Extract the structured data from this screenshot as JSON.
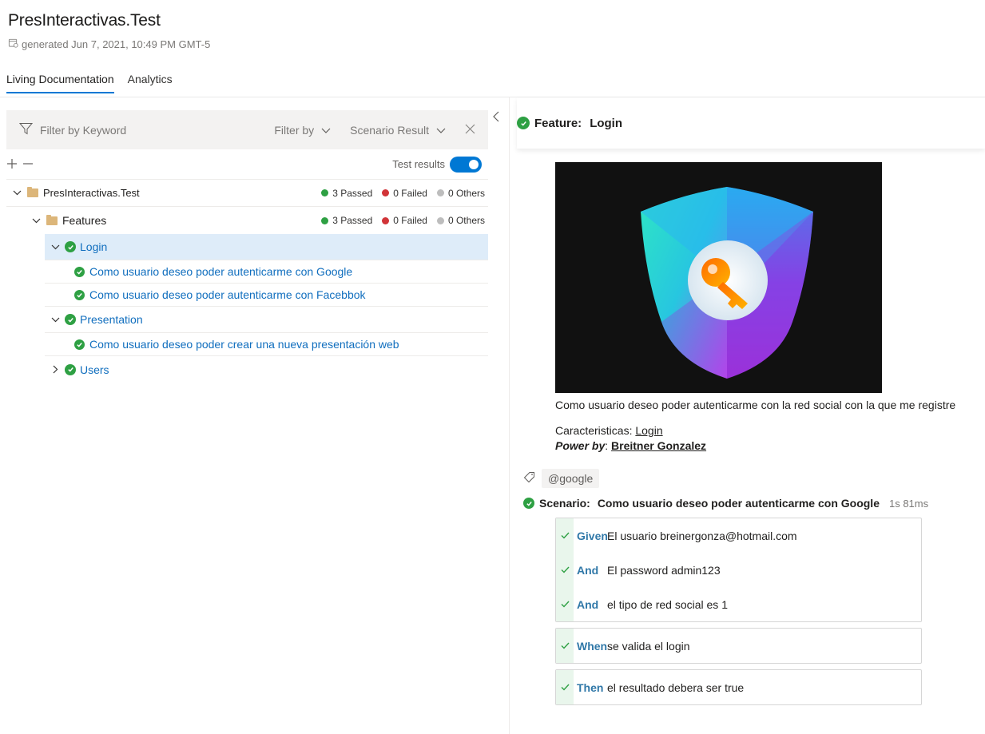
{
  "header": {
    "title": "PresInteractivas.Test",
    "generated": "generated Jun 7, 2021, 10:49 PM GMT-5"
  },
  "tabs": [
    {
      "label": "Living Documentation",
      "active": true
    },
    {
      "label": "Analytics",
      "active": false
    }
  ],
  "filter": {
    "keyword_placeholder": "Filter by Keyword",
    "filter_by": "Filter by",
    "scenario_result": "Scenario Result"
  },
  "toolbar": {
    "test_results_label": "Test results",
    "test_results_on": true
  },
  "tree": {
    "root": {
      "label": "PresInteractivas.Test",
      "passed": "3 Passed",
      "failed": "0 Failed",
      "others": "0 Others"
    },
    "features": {
      "label": "Features",
      "passed": "3 Passed",
      "failed": "0 Failed",
      "others": "0 Others"
    },
    "login": {
      "label": "Login",
      "scenarios": [
        "Como usuario deseo poder autenticarme con Google",
        "Como usuario deseo poder autenticarme con Facebbok"
      ]
    },
    "presentation": {
      "label": "Presentation",
      "scenarios": [
        "Como usuario deseo poder crear una nueva presentación web"
      ]
    },
    "users": {
      "label": "Users"
    }
  },
  "feature": {
    "prefix": "Feature:",
    "name": "Login",
    "description": "Como usuario deseo poder autenticarme con la red social con la que me registre",
    "caracteristicas_label": "Caracteristicas: ",
    "caracteristicas_link": "Login",
    "power_label": "Power by",
    "power_sep": ": ",
    "power_name": "Breitner Gonzalez",
    "tag": "@google",
    "scenario_prefix": "Scenario:",
    "scenario_name": "Como usuario deseo poder autenticarme con Google",
    "scenario_duration": "1s 81ms",
    "steps": [
      {
        "keyword": "Given",
        "text": "El usuario breinergonza@hotmail.com"
      },
      {
        "keyword": "And",
        "text": "El password admin123"
      },
      {
        "keyword": "And",
        "text": "el tipo de red social es 1"
      },
      {
        "keyword": "When",
        "text": "se valida el login"
      },
      {
        "keyword": "Then",
        "text": "el resultado debera ser true"
      }
    ]
  },
  "colors": {
    "accent": "#0078d4",
    "passed": "#2ea043",
    "failed": "#d13438",
    "others": "#bdbdbd",
    "link": "#106ebe",
    "step_keyword": "#3078a8"
  }
}
